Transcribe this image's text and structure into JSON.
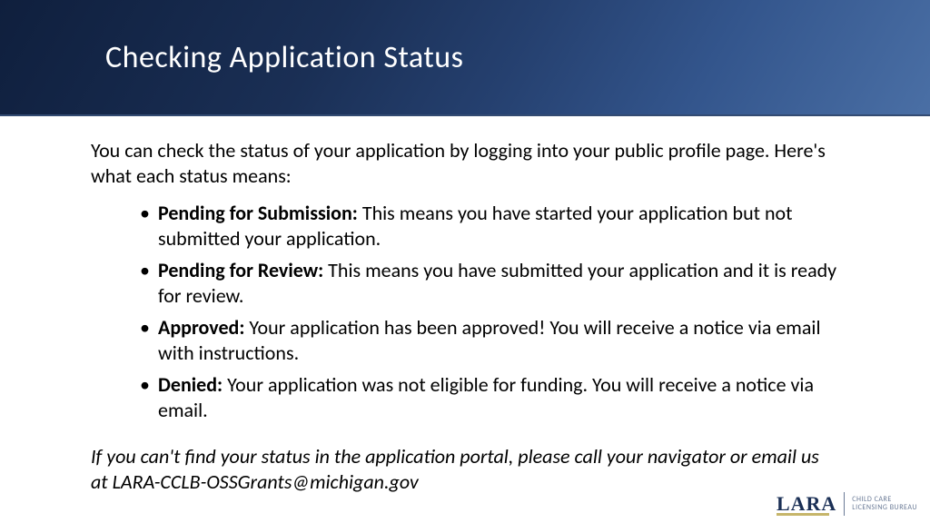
{
  "title": "Checking Application Status",
  "intro": "You can check the status of your application by logging into your public profile page. Here's what each status means:",
  "statuses": [
    {
      "label": "Pending for Submission:",
      "text": " This means you have started your application but not submitted your application."
    },
    {
      "label": "Pending for Review:",
      "text": " This means you have submitted your application and it is ready for review."
    },
    {
      "label": "Approved:",
      "text": " Your application has been approved! You will receive a notice via email with instructions."
    },
    {
      "label": "Denied:",
      "text": " Your application was not eligible for funding. You will receive a notice via email."
    }
  ],
  "footnote": "If you can't find your status in the application portal, please call your navigator or email us at LARA-CCLB-OSSGrants@michigan.gov",
  "logo": {
    "name": "LARA",
    "tag1": "CHILD CARE",
    "tag2": "LICENSING BUREAU"
  }
}
